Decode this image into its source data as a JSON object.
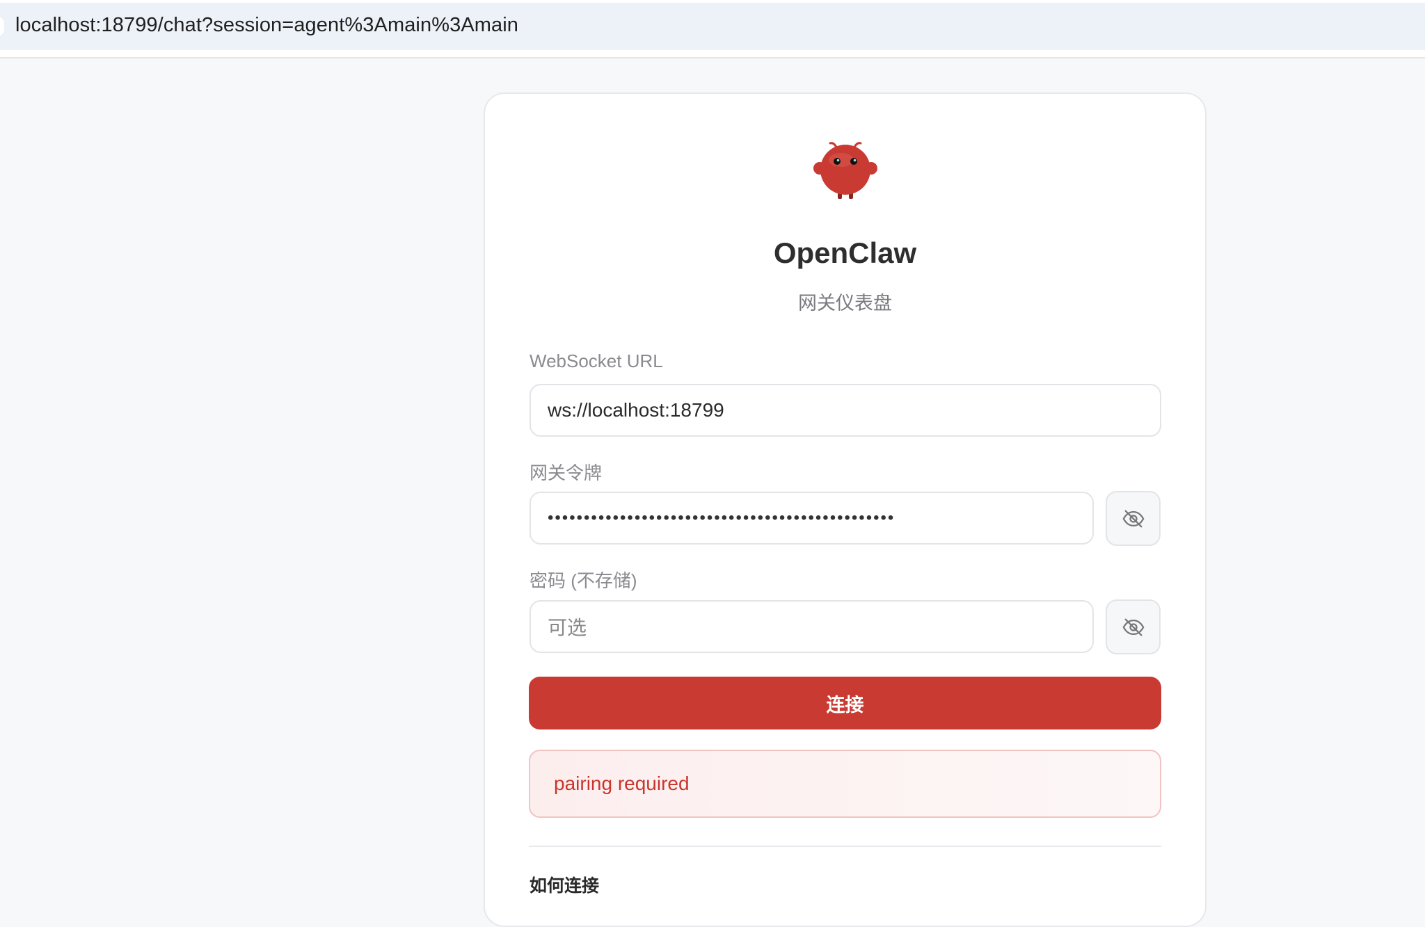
{
  "browser": {
    "url": "localhost:18799/chat?session=agent%3Amain%3Amain"
  },
  "app": {
    "name": "OpenClaw",
    "subtitle": "网关仪表盘",
    "brand_color": "#c93a32"
  },
  "form": {
    "ws_label": "WebSocket URL",
    "ws_value": "ws://localhost:18799",
    "token_label": "网关令牌",
    "token_value_masked": "••••••••••••••••••••••••••••••••••••••••••••••••",
    "password_label": "密码 (不存储)",
    "password_placeholder": "可选",
    "toggle_icon": "eye-off-icon",
    "connect_label": "连接"
  },
  "error": {
    "message": "pairing required"
  },
  "help": {
    "title": "如何连接"
  }
}
